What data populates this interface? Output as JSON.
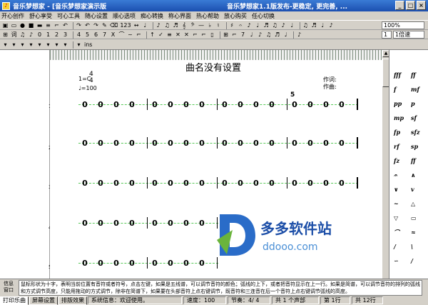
{
  "window": {
    "title": "音乐梦想家 - [音乐梦想家演示版",
    "title_right": "音乐梦想家1.1版发布-更稳定, 更完善, ...",
    "min": "_",
    "max": "□",
    "close": "×"
  },
  "menu": [
    "开心创作",
    "舒心享受",
    "可心工具",
    "随心设置",
    "顺心选项",
    "痴心转换",
    "称心界面",
    "热心帮助",
    "放心购买",
    "任心切换"
  ],
  "toolbar1": {
    "items": [
      "▣",
      "▭",
      "●",
      "■",
      "▬",
      "≡",
      "⌐",
      "↶",
      "↷",
      "↶",
      "↷",
      "✎",
      "⌫",
      "123",
      "↔",
      "♩",
      "♪",
      "♫",
      "♬",
      "𝄞",
      "𝄢",
      "—",
      "♭",
      "♮",
      "♯",
      "𝄐",
      "♪",
      "♩",
      "♬",
      "♫",
      "♪",
      "♩",
      "♫",
      "♬",
      "♩",
      "♪"
    ],
    "zoom": "100%"
  },
  "toolbar2": {
    "items": [
      "⊞",
      "词",
      "♫",
      "♪",
      "0",
      "1",
      "2",
      "3",
      "4",
      "5",
      "6",
      "7",
      "X",
      "⌒",
      "~",
      "⌐",
      "↑",
      "✓",
      "≡",
      "✕",
      "✕",
      "⌐",
      "⌐",
      "▯",
      "⊞",
      "⌐",
      "7",
      "♩",
      "♪",
      "♫",
      "♬",
      "♩",
      "♪"
    ],
    "beat_value": "1",
    "beat_label": "1倍速"
  },
  "toolbar3": {
    "items": [
      "▾",
      "▾",
      "▾",
      "▾",
      "▾",
      "▾",
      "▾",
      "▾",
      "▾",
      "ins"
    ]
  },
  "score": {
    "title": "曲名没有设置",
    "key": "1=C",
    "time_top": "4",
    "time_bottom": "4",
    "tempo": "♩=100",
    "lyricist": "作词:",
    "composer": "作曲:",
    "measure_marker": "5",
    "row_numbers": [
      "1",
      "2",
      "3",
      "4",
      "5"
    ],
    "note": "0"
  },
  "palette": {
    "symbols": [
      "fff",
      "ff",
      "f",
      "mf",
      "pp",
      "p",
      "mp",
      "sf",
      "fp",
      "sfz",
      "rf",
      "sp",
      "fz",
      "ff",
      "𝄐",
      "∧",
      "∨",
      "v",
      "~",
      "△",
      "▽",
      "▭",
      "⌒",
      "≈",
      "/",
      "\\",
      "∽",
      "/"
    ]
  },
  "info": {
    "label": "信息窗口",
    "text": "鼠标形状为十字，表明当前位置有音符或者符号，点击左键，如果是五线谱，可以调节音符的颜色；弧线的上下，或者把音符显示在上一行。如果是简谱，可以调节音符的排列的弧线和方式调节高度，只能用拖动的方式调节，除非在简谱下，如果要在头部音符上点右键调节，既音符和三连音在后一个音符上点右键调节弧线的高度。"
  },
  "status": {
    "tabs": [
      "打印乐曲",
      "屏幕设置",
      "排版效果"
    ],
    "system_info": "系统信息：欢迎使用。",
    "speed": "速度：100",
    "meter": "节奏：4/ 4",
    "parts": "共 1 个声部",
    "current_row": "第 1行",
    "total_rows": "共 12行"
  },
  "watermark": {
    "brand": "多多软件站",
    "url": "ddooo.com"
  },
  "colors": {
    "title_bar": "#1b4fb0",
    "staff_line": "#59c959",
    "accent_blue": "#1a3fd0"
  }
}
